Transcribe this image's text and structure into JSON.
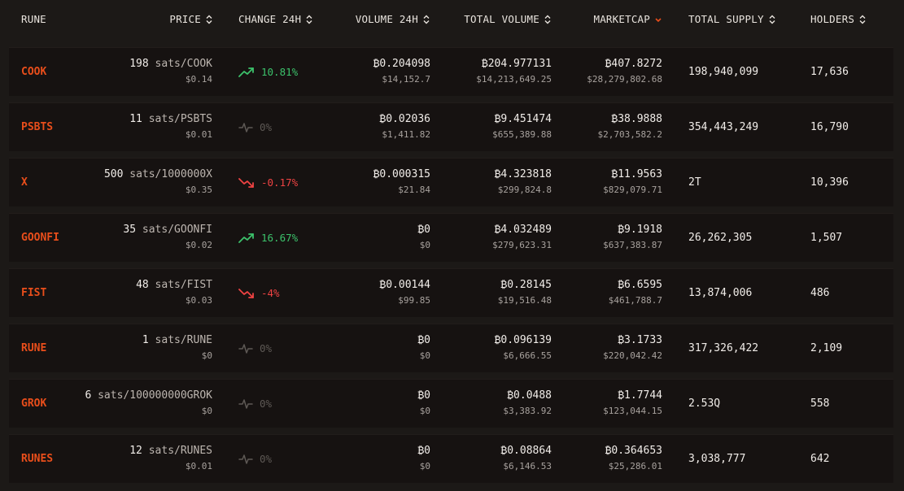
{
  "colors": {
    "accent": "#e94e1b",
    "up": "#3cc26b",
    "down": "#ef4343",
    "flat": "#5e5955",
    "sort_active": "#e94e1b"
  },
  "header": {
    "rune": "RUNE",
    "price": "PRICE",
    "change_24h": "CHANGE 24H",
    "volume_24h": "VOLUME 24H",
    "total_volume": "TOTAL VOLUME",
    "marketcap": "MARKETCAP",
    "total_supply": "TOTAL SUPPLY",
    "holders": "HOLDERS"
  },
  "icons": {
    "sort": "sort-icon",
    "sort_active": "sort-desc-icon",
    "trend_up": "trending-up-icon",
    "trend_down": "trending-down-icon",
    "flat": "activity-icon",
    "btc": "bitcoin-icon"
  },
  "rows": [
    {
      "rune": "COOK",
      "price_sats": "198",
      "price_unit": "sats/COOK",
      "price_usd": "$0.14",
      "change": "10.81%",
      "trend": "up",
      "vol24_btc": "₿0.204098",
      "vol24_usd": "$14,152.7",
      "tvol_btc": "₿204.977131",
      "tvol_usd": "$14,213,649.25",
      "mcap_btc": "₿407.8272",
      "mcap_usd": "$28,279,802.68",
      "supply": "198,940,099",
      "holders": "17,636"
    },
    {
      "rune": "PSBTS",
      "price_sats": "11",
      "price_unit": "sats/PSBTS",
      "price_usd": "$0.01",
      "change": "0%",
      "trend": "flat",
      "vol24_btc": "₿0.02036",
      "vol24_usd": "$1,411.82",
      "tvol_btc": "₿9.451474",
      "tvol_usd": "$655,389.88",
      "mcap_btc": "₿38.9888",
      "mcap_usd": "$2,703,582.2",
      "supply": "354,443,249",
      "holders": "16,790"
    },
    {
      "rune": "X",
      "price_sats": "500",
      "price_unit": "sats/1000000X",
      "price_usd": "$0.35",
      "change": "-0.17%",
      "trend": "down",
      "vol24_btc": "₿0.000315",
      "vol24_usd": "$21.84",
      "tvol_btc": "₿4.323818",
      "tvol_usd": "$299,824.8",
      "mcap_btc": "₿11.9563",
      "mcap_usd": "$829,079.71",
      "supply": "2T",
      "holders": "10,396"
    },
    {
      "rune": "GOONFI",
      "price_sats": "35",
      "price_unit": "sats/GOONFI",
      "price_usd": "$0.02",
      "change": "16.67%",
      "trend": "up",
      "vol24_btc": "₿0",
      "vol24_usd": "$0",
      "tvol_btc": "₿4.032489",
      "tvol_usd": "$279,623.31",
      "mcap_btc": "₿9.1918",
      "mcap_usd": "$637,383.87",
      "supply": "26,262,305",
      "holders": "1,507"
    },
    {
      "rune": "FIST",
      "price_sats": "48",
      "price_unit": "sats/FIST",
      "price_usd": "$0.03",
      "change": "-4%",
      "trend": "down",
      "vol24_btc": "₿0.00144",
      "vol24_usd": "$99.85",
      "tvol_btc": "₿0.28145",
      "tvol_usd": "$19,516.48",
      "mcap_btc": "₿6.6595",
      "mcap_usd": "$461,788.7",
      "supply": "13,874,006",
      "holders": "486"
    },
    {
      "rune": "RUNE",
      "price_sats": "1",
      "price_unit": "sats/RUNE",
      "price_usd": "$0",
      "change": "0%",
      "trend": "flat",
      "vol24_btc": "₿0",
      "vol24_usd": "$0",
      "tvol_btc": "₿0.096139",
      "tvol_usd": "$6,666.55",
      "mcap_btc": "₿3.1733",
      "mcap_usd": "$220,042.42",
      "supply": "317,326,422",
      "holders": "2,109"
    },
    {
      "rune": "GROK",
      "price_sats": "6",
      "price_unit": "sats/100000000GROK",
      "price_usd": "$0",
      "change": "0%",
      "trend": "flat",
      "vol24_btc": "₿0",
      "vol24_usd": "$0",
      "tvol_btc": "₿0.0488",
      "tvol_usd": "$3,383.92",
      "mcap_btc": "₿1.7744",
      "mcap_usd": "$123,044.15",
      "supply": "2.53Q",
      "holders": "558"
    },
    {
      "rune": "RUNES",
      "price_sats": "12",
      "price_unit": "sats/RUNES",
      "price_usd": "$0.01",
      "change": "0%",
      "trend": "flat",
      "vol24_btc": "₿0",
      "vol24_usd": "$0",
      "tvol_btc": "₿0.08864",
      "tvol_usd": "$6,146.53",
      "mcap_btc": "₿0.364653",
      "mcap_usd": "$25,286.01",
      "supply": "3,038,777",
      "holders": "642"
    }
  ]
}
